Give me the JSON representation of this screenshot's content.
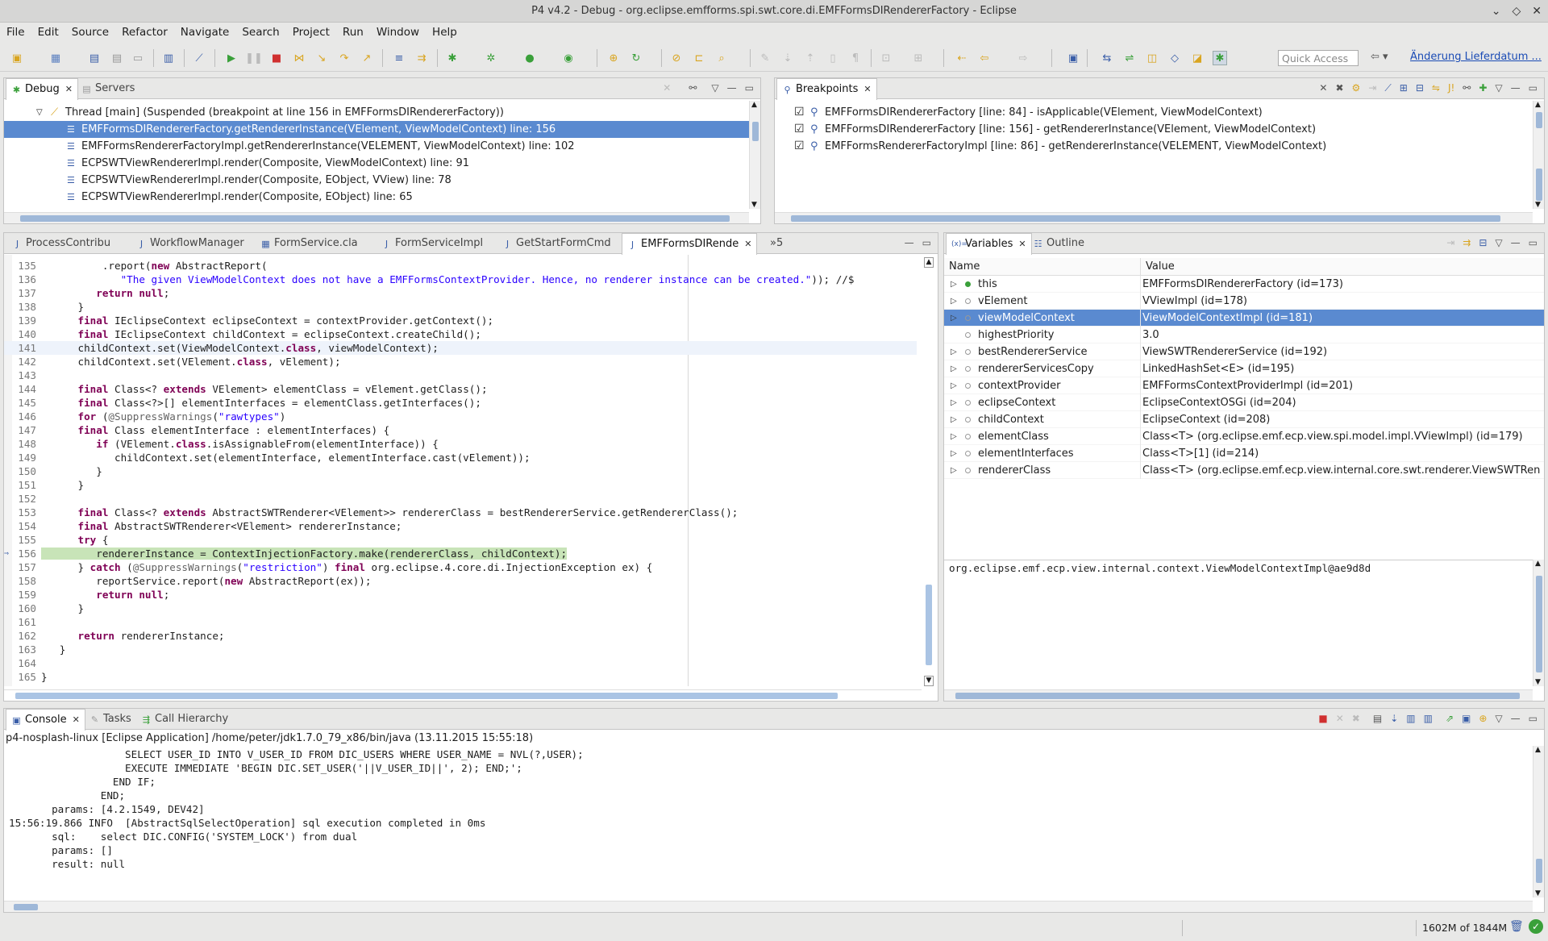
{
  "window": {
    "title": "P4 v4.2 - Debug - org.eclipse.emfforms.spi.swt.core.di.EMFFormsDIRendererFactory - Eclipse",
    "controls": [
      "⌄",
      "◇",
      "✕"
    ]
  },
  "menu": [
    "File",
    "Edit",
    "Source",
    "Refactor",
    "Navigate",
    "Search",
    "Project",
    "Run",
    "Window",
    "Help"
  ],
  "toolbar": {
    "quick_access_placeholder": "Quick Access",
    "link_label": "Änderung Lieferdatum ..."
  },
  "debug_view": {
    "tabs": [
      {
        "label": "Debug",
        "active": true
      },
      {
        "label": "Servers",
        "active": false
      }
    ],
    "thread": "Thread [main] (Suspended (breakpoint at line 156 in EMFFormsDIRendererFactory))",
    "frames": [
      {
        "label": "EMFFormsDIRendererFactory.getRendererInstance(VElement, ViewModelContext) line: 156",
        "selected": true
      },
      {
        "label": "EMFFormsRendererFactoryImpl.getRendererInstance(VELEMENT, ViewModelContext) line: 102",
        "selected": false
      },
      {
        "label": "ECPSWTViewRendererImpl.render(Composite, ViewModelContext) line: 91",
        "selected": false
      },
      {
        "label": "ECPSWTViewRendererImpl.render(Composite, EObject, VView) line: 78",
        "selected": false
      },
      {
        "label": "ECPSWTViewRendererImpl.render(Composite, EObject) line: 65",
        "selected": false
      }
    ]
  },
  "breakpoints_view": {
    "tab": "Breakpoints",
    "items": [
      {
        "label": "EMFFormsDIRendererFactory [line: 84] - isApplicable(VElement, ViewModelContext)",
        "checked": true
      },
      {
        "label": "EMFFormsDIRendererFactory [line: 156] - getRendererInstance(VElement, ViewModelContext)",
        "checked": true
      },
      {
        "label": "EMFFormsRendererFactoryImpl [line: 86] - getRendererInstance(VELEMENT, ViewModelContext)",
        "checked": true
      }
    ]
  },
  "editor": {
    "tabs": [
      {
        "label": "ProcessContribu",
        "active": false
      },
      {
        "label": "WorkflowManager",
        "active": false
      },
      {
        "label": "FormService.cla",
        "active": false
      },
      {
        "label": "FormServiceImpl",
        "active": false
      },
      {
        "label": "GetStartFormCmd",
        "active": false
      },
      {
        "label": "EMFFormsDIRende",
        "active": true
      }
    ],
    "overflow_label": "»5",
    "lines": [
      {
        "n": "135",
        "t": "          .report(new AbstractReport("
      },
      {
        "n": "136",
        "t": "             \"The given ViewModelContext does not have a EMFFormsContextProvider. Hence, no renderer instance can be created.\")); //$"
      },
      {
        "n": "137",
        "t": "         return null;"
      },
      {
        "n": "138",
        "t": "      }"
      },
      {
        "n": "139",
        "t": "      final IEclipseContext eclipseContext = contextProvider.getContext();"
      },
      {
        "n": "140",
        "t": "      final IEclipseContext childContext = eclipseContext.createChild();"
      },
      {
        "n": "141",
        "t": "      childContext.set(ViewModelContext.class, viewModelContext);"
      },
      {
        "n": "142",
        "t": "      childContext.set(VElement.class, vElement);"
      },
      {
        "n": "143",
        "t": ""
      },
      {
        "n": "144",
        "t": "      final Class<? extends VElement> elementClass = vElement.getClass();"
      },
      {
        "n": "145",
        "t": "      final Class<?>[] elementInterfaces = elementClass.getInterfaces();"
      },
      {
        "n": "146",
        "t": "      for (@SuppressWarnings(\"rawtypes\")"
      },
      {
        "n": "147",
        "t": "      final Class elementInterface : elementInterfaces) {"
      },
      {
        "n": "148",
        "t": "         if (VElement.class.isAssignableFrom(elementInterface)) {"
      },
      {
        "n": "149",
        "t": "            childContext.set(elementInterface, elementInterface.cast(vElement));"
      },
      {
        "n": "150",
        "t": "         }"
      },
      {
        "n": "151",
        "t": "      }"
      },
      {
        "n": "152",
        "t": ""
      },
      {
        "n": "153",
        "t": "      final Class<? extends AbstractSWTRenderer<VElement>> rendererClass = bestRendererService.getRendererClass();"
      },
      {
        "n": "154",
        "t": "      final AbstractSWTRenderer<VElement> rendererInstance;"
      },
      {
        "n": "155",
        "t": "      try {"
      },
      {
        "n": "156",
        "t": "         rendererInstance = ContextInjectionFactory.make(rendererClass, childContext);"
      },
      {
        "n": "157",
        "t": "      } catch (@SuppressWarnings(\"restriction\") final org.eclipse.e4.core.di.InjectionException ex) {"
      },
      {
        "n": "158",
        "t": "         reportService.report(new AbstractReport(ex));"
      },
      {
        "n": "159",
        "t": "         return null;"
      },
      {
        "n": "160",
        "t": "      }"
      },
      {
        "n": "161",
        "t": ""
      },
      {
        "n": "162",
        "t": "      return rendererInstance;"
      },
      {
        "n": "163",
        "t": "   }"
      },
      {
        "n": "164",
        "t": ""
      },
      {
        "n": "165",
        "t": "}"
      }
    ],
    "current_line": "156",
    "highlight_line": "141"
  },
  "variables_view": {
    "tabs": [
      {
        "label": "Variables",
        "active": true
      },
      {
        "label": "Outline",
        "active": false
      }
    ],
    "col_name": "Name",
    "col_value": "Value",
    "rows": [
      {
        "name": "this",
        "value": "EMFFormsDIRendererFactory  (id=173)",
        "exp": true,
        "dot": "green"
      },
      {
        "name": "vElement",
        "value": "VViewImpl  (id=178)",
        "exp": true,
        "dot": "plain"
      },
      {
        "name": "viewModelContext",
        "value": "ViewModelContextImpl  (id=181)",
        "exp": true,
        "dot": "plain",
        "selected": true
      },
      {
        "name": "highestPriority",
        "value": "3.0",
        "exp": false,
        "dot": "plain"
      },
      {
        "name": "bestRendererService",
        "value": "ViewSWTRendererService  (id=192)",
        "exp": true,
        "dot": "plain"
      },
      {
        "name": "rendererServicesCopy",
        "value": "LinkedHashSet<E>  (id=195)",
        "exp": true,
        "dot": "plain"
      },
      {
        "name": "contextProvider",
        "value": "EMFFormsContextProviderImpl  (id=201)",
        "exp": true,
        "dot": "plain"
      },
      {
        "name": "eclipseContext",
        "value": "EclipseContextOSGi  (id=204)",
        "exp": true,
        "dot": "plain"
      },
      {
        "name": "childContext",
        "value": "EclipseContext  (id=208)",
        "exp": true,
        "dot": "plain"
      },
      {
        "name": "elementClass",
        "value": "Class<T> (org.eclipse.emf.ecp.view.spi.model.impl.VViewImpl) (id=179)",
        "exp": true,
        "dot": "plain"
      },
      {
        "name": "elementInterfaces",
        "value": "Class<T>[1]  (id=214)",
        "exp": true,
        "dot": "plain"
      },
      {
        "name": "rendererClass",
        "value": "Class<T> (org.eclipse.emf.ecp.view.internal.core.swt.renderer.ViewSWTRender",
        "exp": true,
        "dot": "plain"
      }
    ],
    "detail": "org.eclipse.emf.ecp.view.internal.context.ViewModelContextImpl@ae9d8d"
  },
  "console_view": {
    "tabs": [
      {
        "label": "Console",
        "active": true
      },
      {
        "label": "Tasks",
        "active": false
      },
      {
        "label": "Call Hierarchy",
        "active": false
      }
    ],
    "process": "p4-nosplash-linux [Eclipse Application] /home/peter/jdk1.7.0_79_x86/bin/java (13.11.2015 15:55:18)",
    "lines": [
      "                   SELECT USER_ID INTO V_USER_ID FROM DIC_USERS WHERE USER_NAME = NVL(?,USER);",
      "                   EXECUTE IMMEDIATE 'BEGIN DIC.SET_USER('||V_USER_ID||', 2); END;';",
      "                 END IF;",
      "               END;",
      "       params: [4.2.1549, DEV42]",
      "15:56:19.866 INFO  [AbstractSqlSelectOperation] sql execution completed in 0ms",
      "       sql:    select DIC.CONFIG('SYSTEM_LOCK') from dual",
      "       params: []",
      "       result: null"
    ]
  },
  "status": {
    "heap": "1602M of 1844M"
  }
}
